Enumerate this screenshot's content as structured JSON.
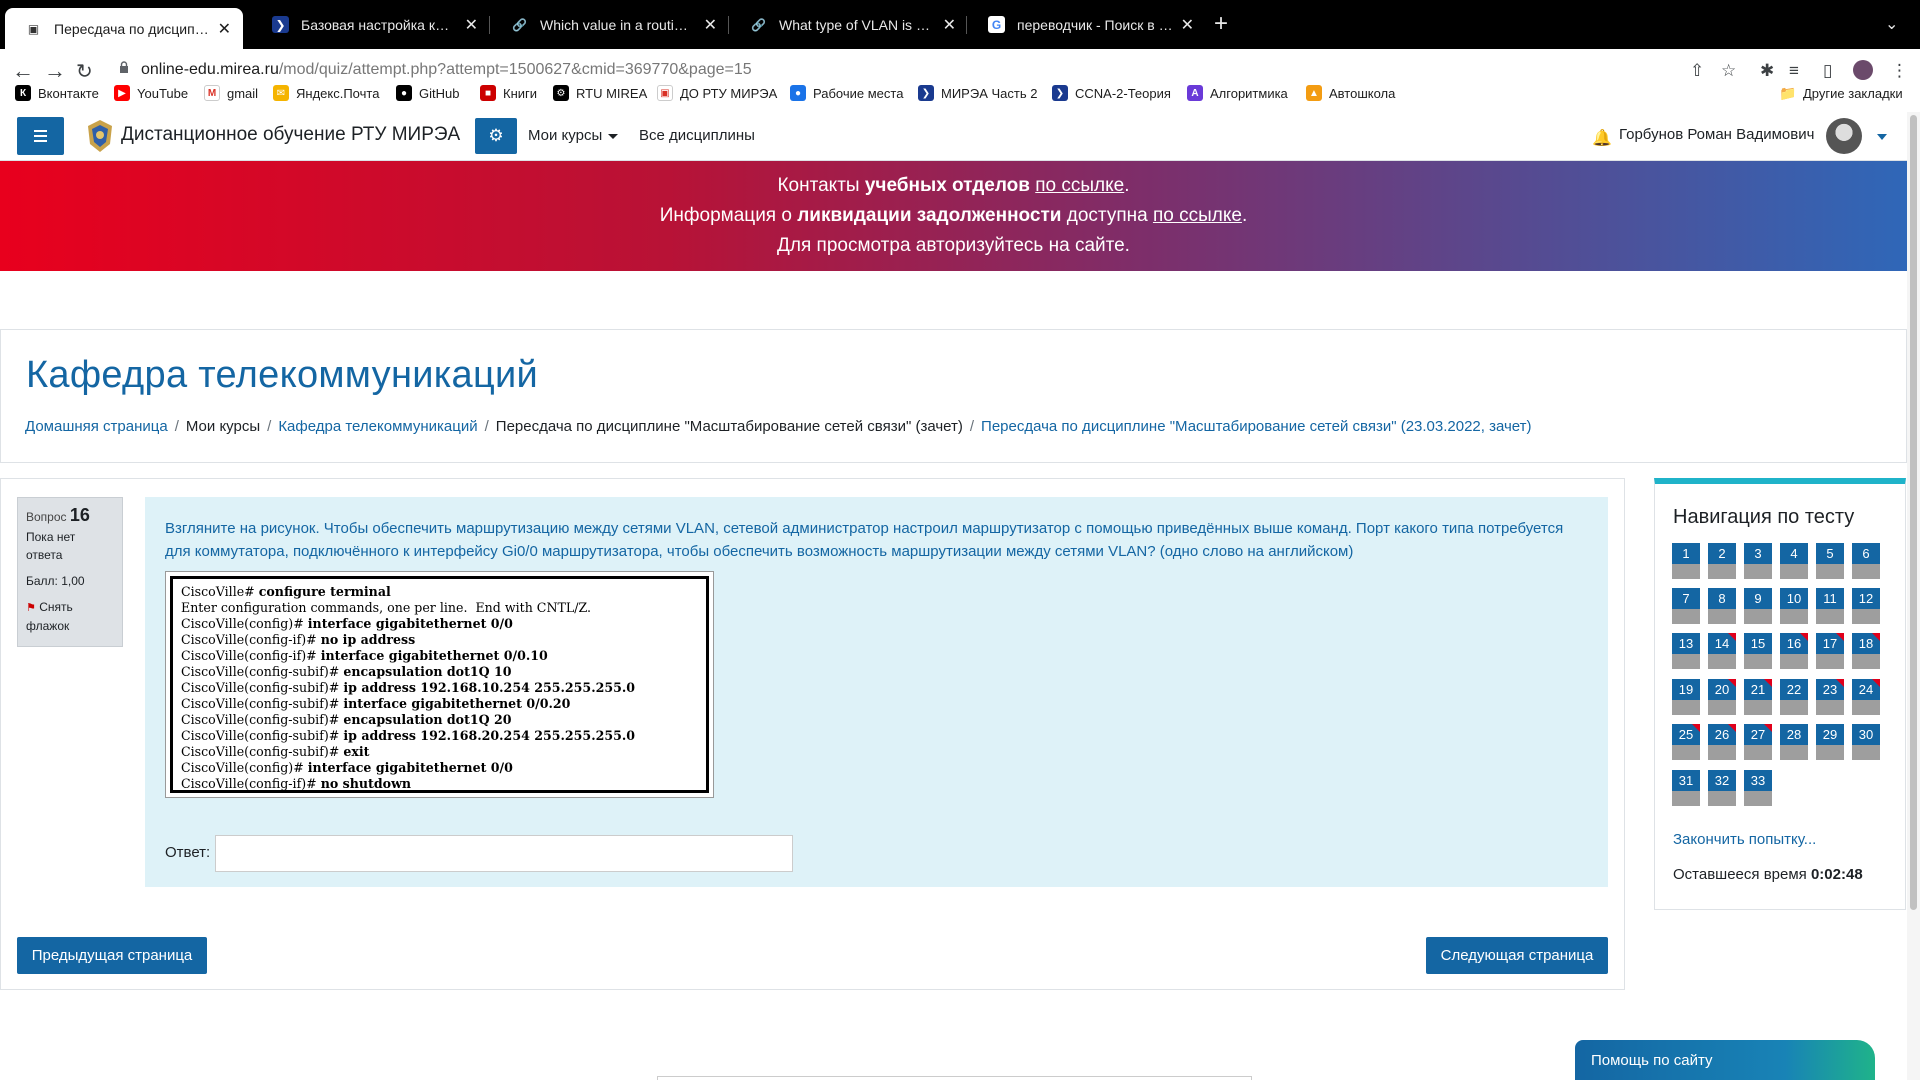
{
  "browser": {
    "tabs": [
      {
        "title": "Пересдача по дисциплине \"Масштабирование сетей связи\"",
        "active": true,
        "icon": "moodle-icon"
      },
      {
        "title": "Базовая настройка коммутатора",
        "active": false,
        "icon": "ccna-icon"
      },
      {
        "title": "Which value in a routing table repr",
        "active": false,
        "icon": "link-icon"
      },
      {
        "title": "What type of VLAN is configured",
        "active": false,
        "icon": "link-icon"
      },
      {
        "title": "переводчик - Поиск в Google",
        "active": false,
        "icon": "google-icon"
      }
    ],
    "url_host": "online-edu.mirea.ru",
    "url_path": "/mod/quiz/attempt.php?attempt=1500627&cmid=369770&page=15",
    "bookmarks": [
      {
        "label": "Вконтакте",
        "icon": "vk-icon",
        "color": "#000000"
      },
      {
        "label": "YouTube",
        "icon": "youtube-icon",
        "color": "#ff0000"
      },
      {
        "label": "gmail",
        "icon": "gmail-icon",
        "color": "#ffffff"
      },
      {
        "label": "Яндекс.Почта",
        "icon": "mail-icon",
        "color": "#f5b400"
      },
      {
        "label": "GitHub",
        "icon": "github-icon",
        "color": "#000000"
      },
      {
        "label": "Книги",
        "icon": "books-icon",
        "color": "#cc0000"
      },
      {
        "label": "RTU MIREA",
        "icon": "rtu-icon",
        "color": "#000000"
      },
      {
        "label": "ДО РТУ МИРЭА",
        "icon": "page-icon",
        "color": "#ffffff"
      },
      {
        "label": "Рабочие места",
        "icon": "globe-icon",
        "color": "#1a73e8"
      },
      {
        "label": "МИРЭА Часть 2",
        "icon": "ccna-icon",
        "color": "#1a3a8f"
      },
      {
        "label": "CCNA-2-Теория",
        "icon": "ccna-icon",
        "color": "#1a3a8f"
      },
      {
        "label": "Алгоритмика",
        "icon": "algo-icon",
        "color": "#6a3ad8"
      },
      {
        "label": "Автошкола",
        "icon": "cone-icon",
        "color": "#f39c12"
      }
    ],
    "other_bookmarks": "Другие закладки"
  },
  "navbar": {
    "brand": "Дистанционное обучение РТУ МИРЭА",
    "my_courses": "Мои курсы",
    "all_disciplines": "Все дисциплины",
    "user_name": "Горбунов Роман Вадимович"
  },
  "banner": {
    "line1_pre": "Контакты ",
    "line1_bold": "учебных отделов",
    "line1_mid": " ",
    "line1_link": "по ссылке",
    "line1_post": ".",
    "line2_pre": "Информация о ",
    "line2_bold": "ликвидации задолженности",
    "line2_mid": " доступна ",
    "line2_link": "по ссылке",
    "line2_post": ".",
    "line3": "Для просмотра авторизуйтесь на сайте."
  },
  "page": {
    "title": "Кафедра телекоммуникаций",
    "breadcrumbs": [
      {
        "label": "Домашняя страница",
        "link": true
      },
      {
        "label": "Мои курсы",
        "link": false
      },
      {
        "label": "Кафедра телекоммуникаций",
        "link": true
      },
      {
        "label": "Пересдача по дисциплине \"Масштабирование сетей связи\" (зачет)",
        "link": false
      },
      {
        "label": "Пересдача по дисциплине \"Масштабирование сетей связи\" (23.03.2022, зачет)",
        "link": true
      }
    ]
  },
  "question": {
    "label": "Вопрос",
    "number": "16",
    "state": "Пока нет ответа",
    "mark": "Балл: 1,00",
    "flag": "Снять флажок",
    "text": "Взгляните на рисунок. Чтобы обеспечить маршрутизацию между сетями VLAN, сетевой администратор настроил маршрутизатор с помощью приведённых выше команд. Порт какого типа потребуется для коммутатора, подключённого к интерфейсу Gi0/0 маршрутизатора, чтобы обеспечить возможность маршрутизации между сетями VLAN? (одно слово на английском)",
    "code_lines": [
      {
        "prompt": "CiscoVille# ",
        "cmd": "configure terminal"
      },
      {
        "prompt": "Enter configuration commands, one per line.  End with CNTL/Z.",
        "cmd": ""
      },
      {
        "prompt": "CiscoVille(config)# ",
        "cmd": "interface gigabitethernet 0/0"
      },
      {
        "prompt": "CiscoVille(config-if)# ",
        "cmd": "no ip address"
      },
      {
        "prompt": "CiscoVille(config-if)# ",
        "cmd": "interface gigabitethernet 0/0.10"
      },
      {
        "prompt": "CiscoVille(config-subif)# ",
        "cmd": "encapsulation dot1Q 10"
      },
      {
        "prompt": "CiscoVille(config-subif)# ",
        "cmd": "ip address 192.168.10.254 255.255.255.0"
      },
      {
        "prompt": "CiscoVille(config-subif)# ",
        "cmd": "interface gigabitethernet 0/0.20"
      },
      {
        "prompt": "CiscoVille(config-subif)# ",
        "cmd": "encapsulation dot1Q 20"
      },
      {
        "prompt": "CiscoVille(config-subif)# ",
        "cmd": "ip address 192.168.20.254 255.255.255.0"
      },
      {
        "prompt": "CiscoVille(config-subif)# ",
        "cmd": "exit"
      },
      {
        "prompt": "CiscoVille(config)# ",
        "cmd": "interface gigabitethernet 0/0"
      },
      {
        "prompt": "CiscoVille(config-if)# ",
        "cmd": "no shutdown"
      }
    ],
    "answer_label": "Ответ:",
    "answer_value": ""
  },
  "buttons": {
    "prev": "Предыдущая страница",
    "next": "Следующая страница"
  },
  "quiz_nav": {
    "title": "Навигация по тесту",
    "flagged": [
      14,
      16,
      17,
      18,
      20,
      21,
      23,
      24,
      25,
      26,
      27
    ],
    "total": 33,
    "finish": "Закончить попытку...",
    "time_label": "Оставшееся время",
    "time_value": "0:02:48"
  },
  "help": "Помощь по сайту"
}
